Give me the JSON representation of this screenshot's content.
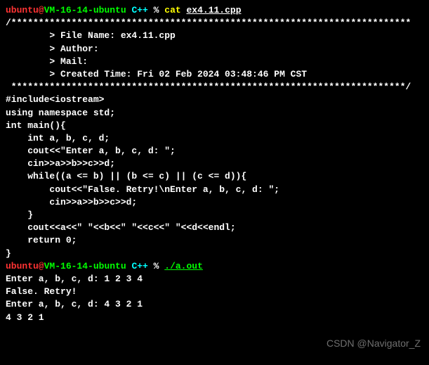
{
  "prompt1": {
    "user": "ubuntu",
    "at": "@",
    "host": "VM-16-14-ubuntu",
    "path": " C++",
    "dollar": " % ",
    "cmd": "cat ",
    "arg": "ex4.11.cpp"
  },
  "file_header": {
    "star_top": "/*************************************************************************",
    "file_name": "        > File Name: ex4.11.cpp",
    "author": "        > Author:",
    "mail": "        > Mail:",
    "created": "        > Created Time: Fri 02 Feb 2024 03:48:46 PM CST",
    "star_bot": " ************************************************************************/"
  },
  "code": {
    "blank1": "",
    "l1": "#include<iostream>",
    "l2": "using namespace std;",
    "blank2": "",
    "l3": "int main(){",
    "l4": "    int a, b, c, d;",
    "l5": "    cout<<\"Enter a, b, c, d: \";",
    "l6": "    cin>>a>>b>>c>>d;",
    "l7": "    while((a <= b) || (b <= c) || (c <= d)){",
    "l8": "        cout<<\"False. Retry!\\nEnter a, b, c, d: \";",
    "l9": "        cin>>a>>b>>c>>d;",
    "l10": "    }",
    "l11": "    cout<<a<<\" \"<<b<<\" \"<<c<<\" \"<<d<<endl;",
    "l12": "    return 0;",
    "l13": "}"
  },
  "prompt2": {
    "user": "ubuntu",
    "at": "@",
    "host": "VM-16-14-ubuntu",
    "path": " C++",
    "dollar": " % ",
    "cmd": "./a.out"
  },
  "output": {
    "o1": "Enter a, b, c, d: 1 2 3 4",
    "o2": "False. Retry!",
    "o3": "Enter a, b, c, d: 4 3 2 1",
    "o4": "4 3 2 1"
  },
  "watermark": "CSDN @Navigator_Z"
}
